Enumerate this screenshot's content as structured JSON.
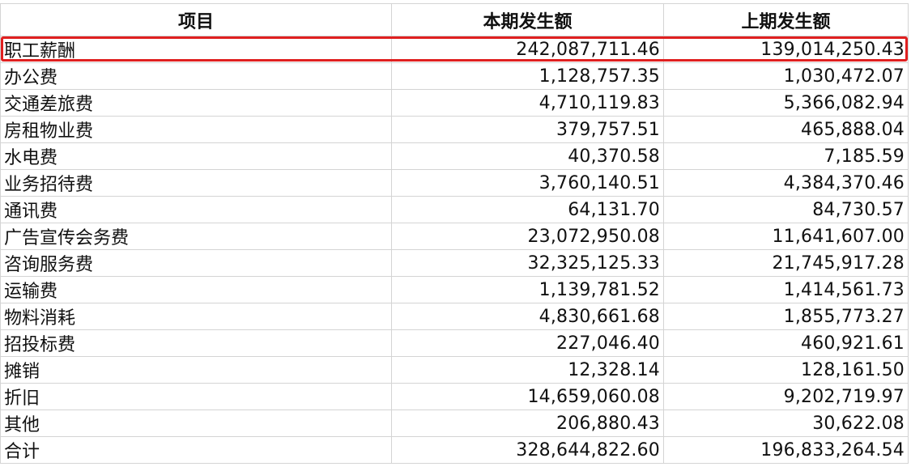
{
  "header": {
    "item": "项目",
    "current": "本期发生额",
    "previous": "上期发生额"
  },
  "rows": [
    {
      "item": "职工薪酬",
      "current": "242,087,711.46",
      "previous": "139,014,250.43"
    },
    {
      "item": "办公费",
      "current": "1,128,757.35",
      "previous": "1,030,472.07"
    },
    {
      "item": "交通差旅费",
      "current": "4,710,119.83",
      "previous": "5,366,082.94"
    },
    {
      "item": "房租物业费",
      "current": "379,757.51",
      "previous": "465,888.04"
    },
    {
      "item": "水电费",
      "current": "40,370.58",
      "previous": "7,185.59"
    },
    {
      "item": "业务招待费",
      "current": "3,760,140.51",
      "previous": "4,384,370.46"
    },
    {
      "item": "通讯费",
      "current": "64,131.70",
      "previous": "84,730.57"
    },
    {
      "item": "广告宣传会务费",
      "current": "23,072,950.08",
      "previous": "11,641,607.00"
    },
    {
      "item": "咨询服务费",
      "current": "32,325,125.33",
      "previous": "21,745,917.28"
    },
    {
      "item": "运输费",
      "current": "1,139,781.52",
      "previous": "1,414,561.73"
    },
    {
      "item": "物料消耗",
      "current": "4,830,661.68",
      "previous": "1,855,773.27"
    },
    {
      "item": "招投标费",
      "current": "227,046.40",
      "previous": "460,921.61"
    },
    {
      "item": "摊销",
      "current": "12,328.14",
      "previous": "128,161.50"
    },
    {
      "item": "折旧",
      "current": "14,659,060.08",
      "previous": "9,202,719.97"
    },
    {
      "item": "其他",
      "current": "206,880.43",
      "previous": "30,622.08"
    },
    {
      "item": "合计",
      "current": "328,644,822.60",
      "previous": "196,833,264.54"
    }
  ],
  "highlight_color": "#e02020"
}
